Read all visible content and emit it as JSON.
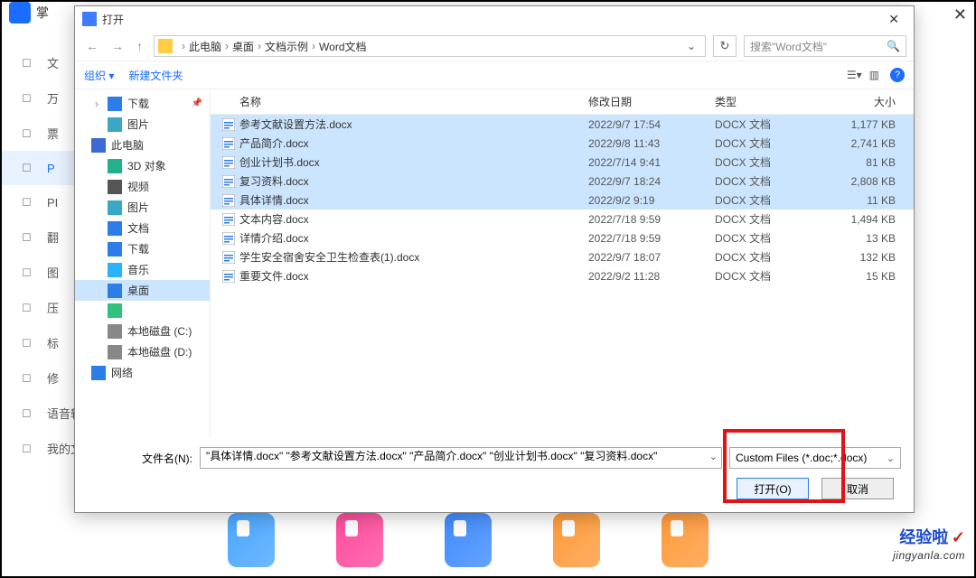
{
  "bg": {
    "app_title": "掌",
    "close_glyph": "✕",
    "sidebar": [
      {
        "icon": "text-icon",
        "label": "文"
      },
      {
        "icon": "camera-icon",
        "label": "万"
      },
      {
        "icon": "ticket-icon",
        "label": "票"
      },
      {
        "icon": "pdf-icon",
        "label": "P",
        "active": true
      },
      {
        "icon": "clock-icon",
        "label": "PI"
      },
      {
        "icon": "translate-icon",
        "label": "翻"
      },
      {
        "icon": "image-icon",
        "label": "图"
      },
      {
        "icon": "archive-icon",
        "label": "压"
      },
      {
        "icon": "bookmark-icon",
        "label": "标"
      },
      {
        "icon": "edit-icon",
        "label": "修"
      },
      {
        "icon": "voice-icon",
        "label": "语音转换"
      },
      {
        "icon": "file-icon",
        "label": "我的文件"
      }
    ],
    "doc_colors": [
      "#4aa6ff",
      "#ff4a9d",
      "#3e8bff",
      "#ff9a3a",
      "#ff9a3a"
    ],
    "watermark_a": "经验啦",
    "watermark_b": "✓",
    "watermark_url": "jingyanla.com"
  },
  "dialog": {
    "title": "打开",
    "breadcrumb_icon": "folder-icon",
    "breadcrumb": [
      "此电脑",
      "桌面",
      "文档示例",
      "Word文档"
    ],
    "refresh_glyph": "↻",
    "search_placeholder": "搜索\"Word文档\"",
    "toolbar": {
      "organize": "组织",
      "organize_dd": "▾",
      "new_folder": "新建文件夹",
      "help_glyph": "?"
    },
    "tree": [
      {
        "icon": "#2b7de9",
        "label": "下载",
        "pin": true,
        "indent": true,
        "arrow": "›",
        "icon_name": "download-icon"
      },
      {
        "icon": "#3aa6c8",
        "label": "图片",
        "indent": true,
        "icon_name": "pictures-icon"
      },
      {
        "icon": "#3a6ad4",
        "label": "此电脑",
        "bold": true,
        "icon_name": "computer-icon"
      },
      {
        "icon": "#20b28a",
        "label": "3D 对象",
        "indent": true,
        "icon_name": "3d-icon"
      },
      {
        "icon": "#555",
        "label": "视频",
        "indent": true,
        "icon_name": "video-icon"
      },
      {
        "icon": "#3aa6c8",
        "label": "图片",
        "indent": true,
        "icon_name": "pictures-icon"
      },
      {
        "icon": "#2b7de9",
        "label": "文档",
        "indent": true,
        "icon_name": "documents-icon"
      },
      {
        "icon": "#2b7de9",
        "label": "下载",
        "indent": true,
        "icon_name": "download-icon"
      },
      {
        "icon": "#2bb2ff",
        "label": "音乐",
        "indent": true,
        "icon_name": "music-icon"
      },
      {
        "icon": "#2b7de9",
        "label": "桌面",
        "indent": true,
        "selected": true,
        "icon_name": "desktop-icon"
      },
      {
        "icon": "#2ec27e",
        "label": "",
        "indent": true,
        "icon_name": "app-icon"
      },
      {
        "icon": "#888",
        "label": "本地磁盘 (C:)",
        "indent": true,
        "icon_name": "drive-icon"
      },
      {
        "icon": "#888",
        "label": "本地磁盘 (D:)",
        "indent": true,
        "icon_name": "drive-icon"
      },
      {
        "icon": "#2b7de9",
        "label": "网络",
        "icon_name": "network-icon"
      }
    ],
    "columns": {
      "name": "名称",
      "date": "修改日期",
      "type": "类型",
      "size": "大小"
    },
    "files": [
      {
        "name": "参考文献设置方法.docx",
        "date": "2022/9/7 17:54",
        "type": "DOCX 文档",
        "size": "1,177 KB",
        "sel": true
      },
      {
        "name": "产品简介.docx",
        "date": "2022/9/8 11:43",
        "type": "DOCX 文档",
        "size": "2,741 KB",
        "sel": true
      },
      {
        "name": "创业计划书.docx",
        "date": "2022/7/14 9:41",
        "type": "DOCX 文档",
        "size": "81 KB",
        "sel": true
      },
      {
        "name": "复习资料.docx",
        "date": "2022/9/7 18:24",
        "type": "DOCX 文档",
        "size": "2,808 KB",
        "sel": true
      },
      {
        "name": "具体详情.docx",
        "date": "2022/9/2 9:19",
        "type": "DOCX 文档",
        "size": "11 KB",
        "sel": true
      },
      {
        "name": "文本内容.docx",
        "date": "2022/7/18 9:59",
        "type": "DOCX 文档",
        "size": "1,494 KB",
        "sel": false
      },
      {
        "name": "详情介绍.docx",
        "date": "2022/7/18 9:59",
        "type": "DOCX 文档",
        "size": "13 KB",
        "sel": false
      },
      {
        "name": "学生安全宿舍安全卫生检查表(1).docx",
        "date": "2022/9/7 18:07",
        "type": "DOCX 文档",
        "size": "132 KB",
        "sel": false
      },
      {
        "name": "重要文件.docx",
        "date": "2022/9/2 11:28",
        "type": "DOCX 文档",
        "size": "15 KB",
        "sel": false
      }
    ],
    "filename_label": "文件名(N):",
    "filename_value": "\"具体详情.docx\" \"参考文献设置方法.docx\" \"产品简介.docx\" \"创业计划书.docx\" \"复习资料.docx\"",
    "filter_label": "Custom Files (*.doc;*.docx)",
    "open_btn": "打开(O)",
    "cancel_btn": "取消"
  }
}
